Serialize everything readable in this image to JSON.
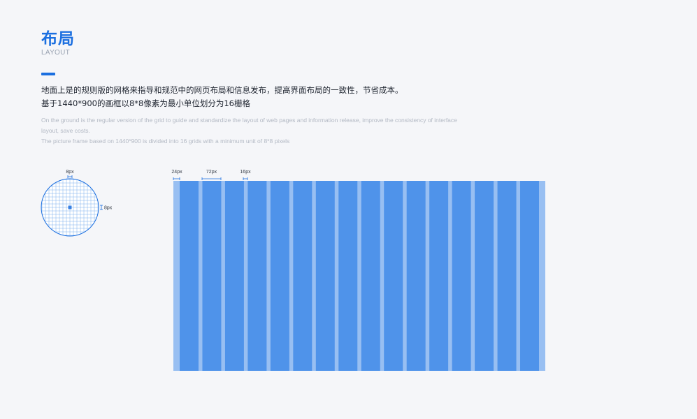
{
  "header": {
    "title": "布局",
    "subtitle": "LAYOUT"
  },
  "description": {
    "cn_line1": "地面上是的规则版的网格来指导和规范中的网页布局和信息发布，提高界面布局的一致性，节省成本。",
    "cn_line2": "基于1440*900的画框以8*8像素为最小单位划分为16栅格",
    "en_line1": "On the ground is the regular version of the grid to guide and standardize the layout of web pages and information release, improve the consistency of interface",
    "en_line2": "layout, save costs.",
    "en_line3": "The picture frame based on 1440*900 is divided into 16 grids with a minimum unit of 8*8 pixels"
  },
  "circle_grid": {
    "top_label": "8px",
    "side_label": "8px"
  },
  "column_grid": {
    "margin_label": "24px",
    "column_label": "72px",
    "gutter_label": "16px",
    "columns": 16,
    "column_color": "#4f93ea",
    "gutter_color": "#98bff2"
  },
  "colors": {
    "accent": "#1b6fe0",
    "background": "#f5f6f9"
  }
}
